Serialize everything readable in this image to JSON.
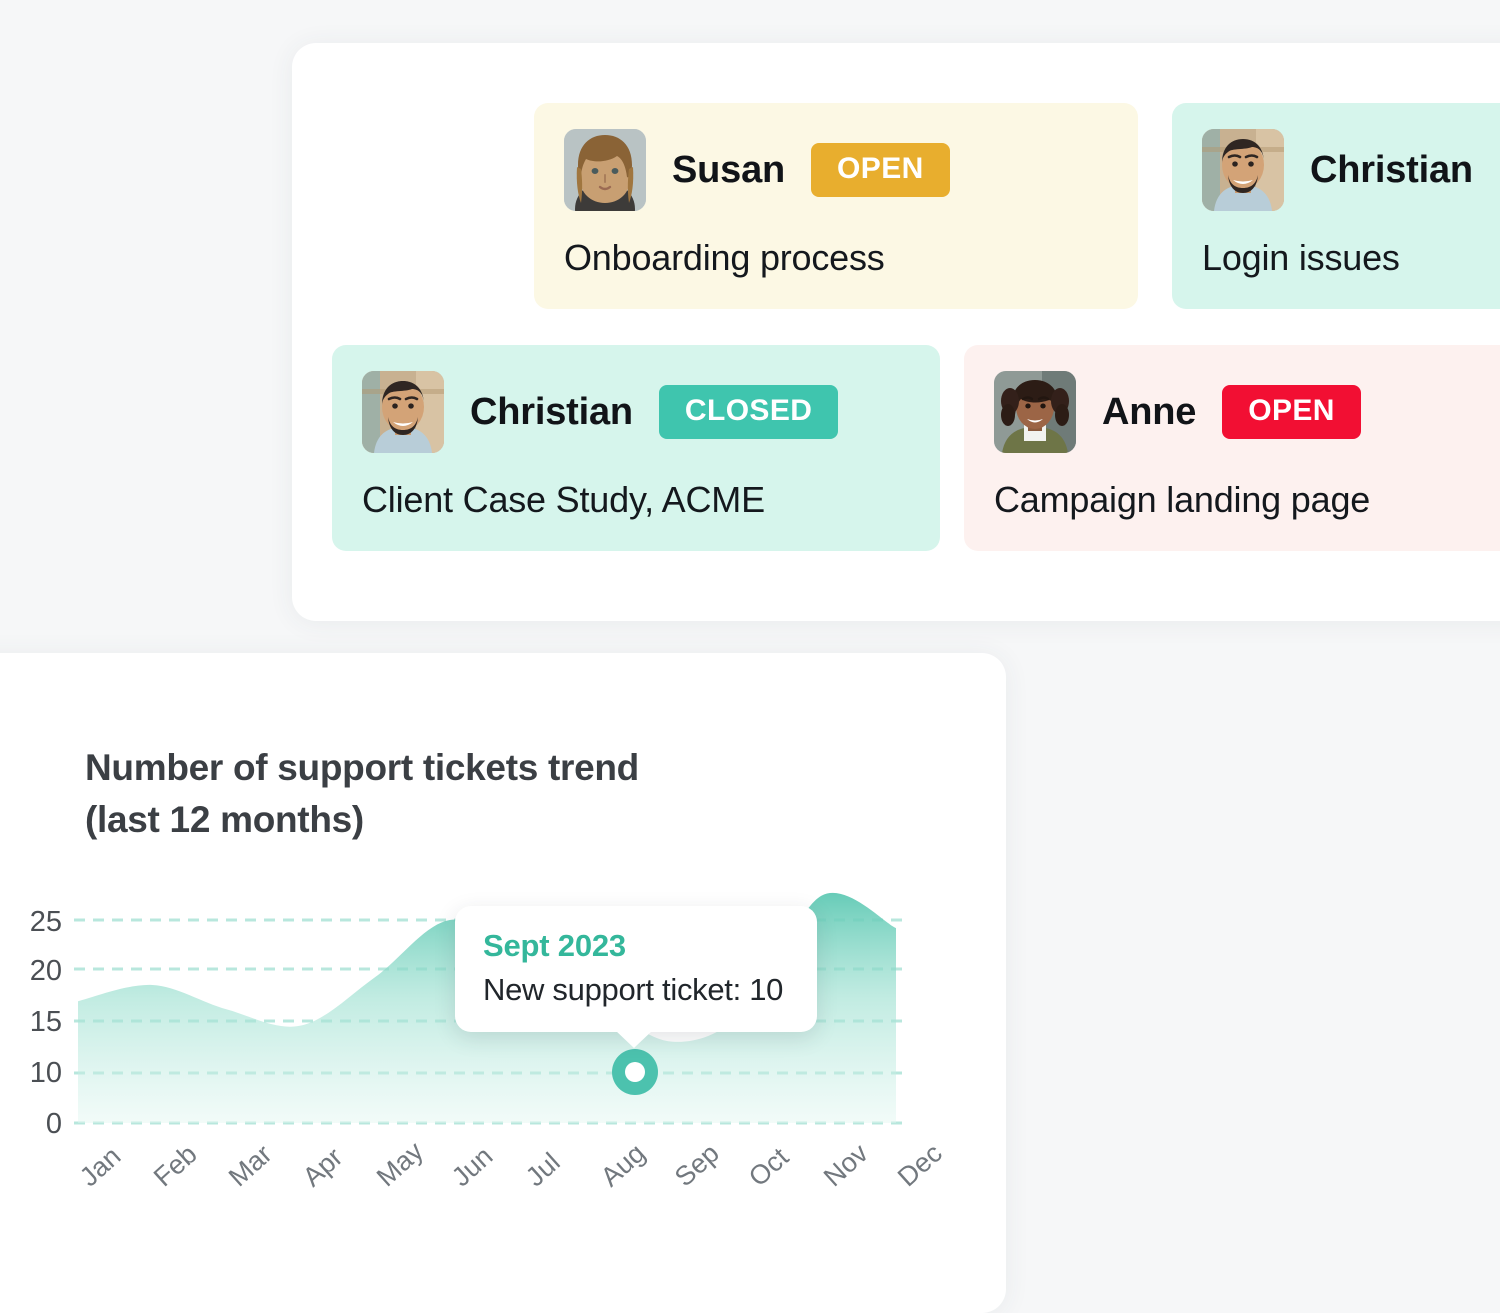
{
  "page": {
    "background_color": "#f6f7f8"
  },
  "tickets_panel": {
    "cards": [
      {
        "id": "susan",
        "name": "Susan",
        "subject": "Onboarding process",
        "status": "OPEN",
        "status_color": "#e8ae2e",
        "card_color": "#fcf8e4",
        "avatar": "avatar-susan"
      },
      {
        "id": "christian-login",
        "name": "Christian",
        "subject": "Login issues",
        "status": "",
        "status_color": "",
        "card_color": "#d6f5ec",
        "avatar": "avatar-christian"
      },
      {
        "id": "christian-case",
        "name": "Christian",
        "subject": "Client Case Study, ACME",
        "status": "CLOSED",
        "status_color": "#3fc5ae",
        "card_color": "#d6f5ec",
        "avatar": "avatar-christian"
      },
      {
        "id": "anne",
        "name": "Anne",
        "subject": "Campaign landing page",
        "status": "OPEN",
        "status_color": "#f20f33",
        "card_color": "#fdf1ef",
        "avatar": "avatar-anne"
      }
    ]
  },
  "chart_panel": {
    "title_line1": "Number of support tickets trend",
    "title_line2": "(last 12 months)",
    "tooltip": {
      "title": "Sept 2023",
      "value": "New support ticket: 10"
    }
  },
  "chart_data": {
    "type": "area",
    "title": "Number of support tickets trend (last 12 months)",
    "xlabel": "",
    "ylabel": "",
    "categories": [
      "Jan",
      "Feb",
      "Mar",
      "Apr",
      "May",
      "Jun",
      "Jul",
      "Aug",
      "Sep",
      "Oct",
      "Nov",
      "Dec"
    ],
    "values": [
      15,
      17,
      14,
      12,
      18,
      25,
      21,
      15,
      10,
      14,
      28,
      24
    ],
    "ylim": [
      0,
      27
    ],
    "yticks": [
      0,
      10,
      15,
      20,
      25
    ],
    "grid": true,
    "legend": "none",
    "series_color": "#7fd4c2",
    "highlight": {
      "category": "Sep",
      "label": "Sept 2023",
      "value": 10,
      "annotation": "New support ticket: 10"
    }
  }
}
